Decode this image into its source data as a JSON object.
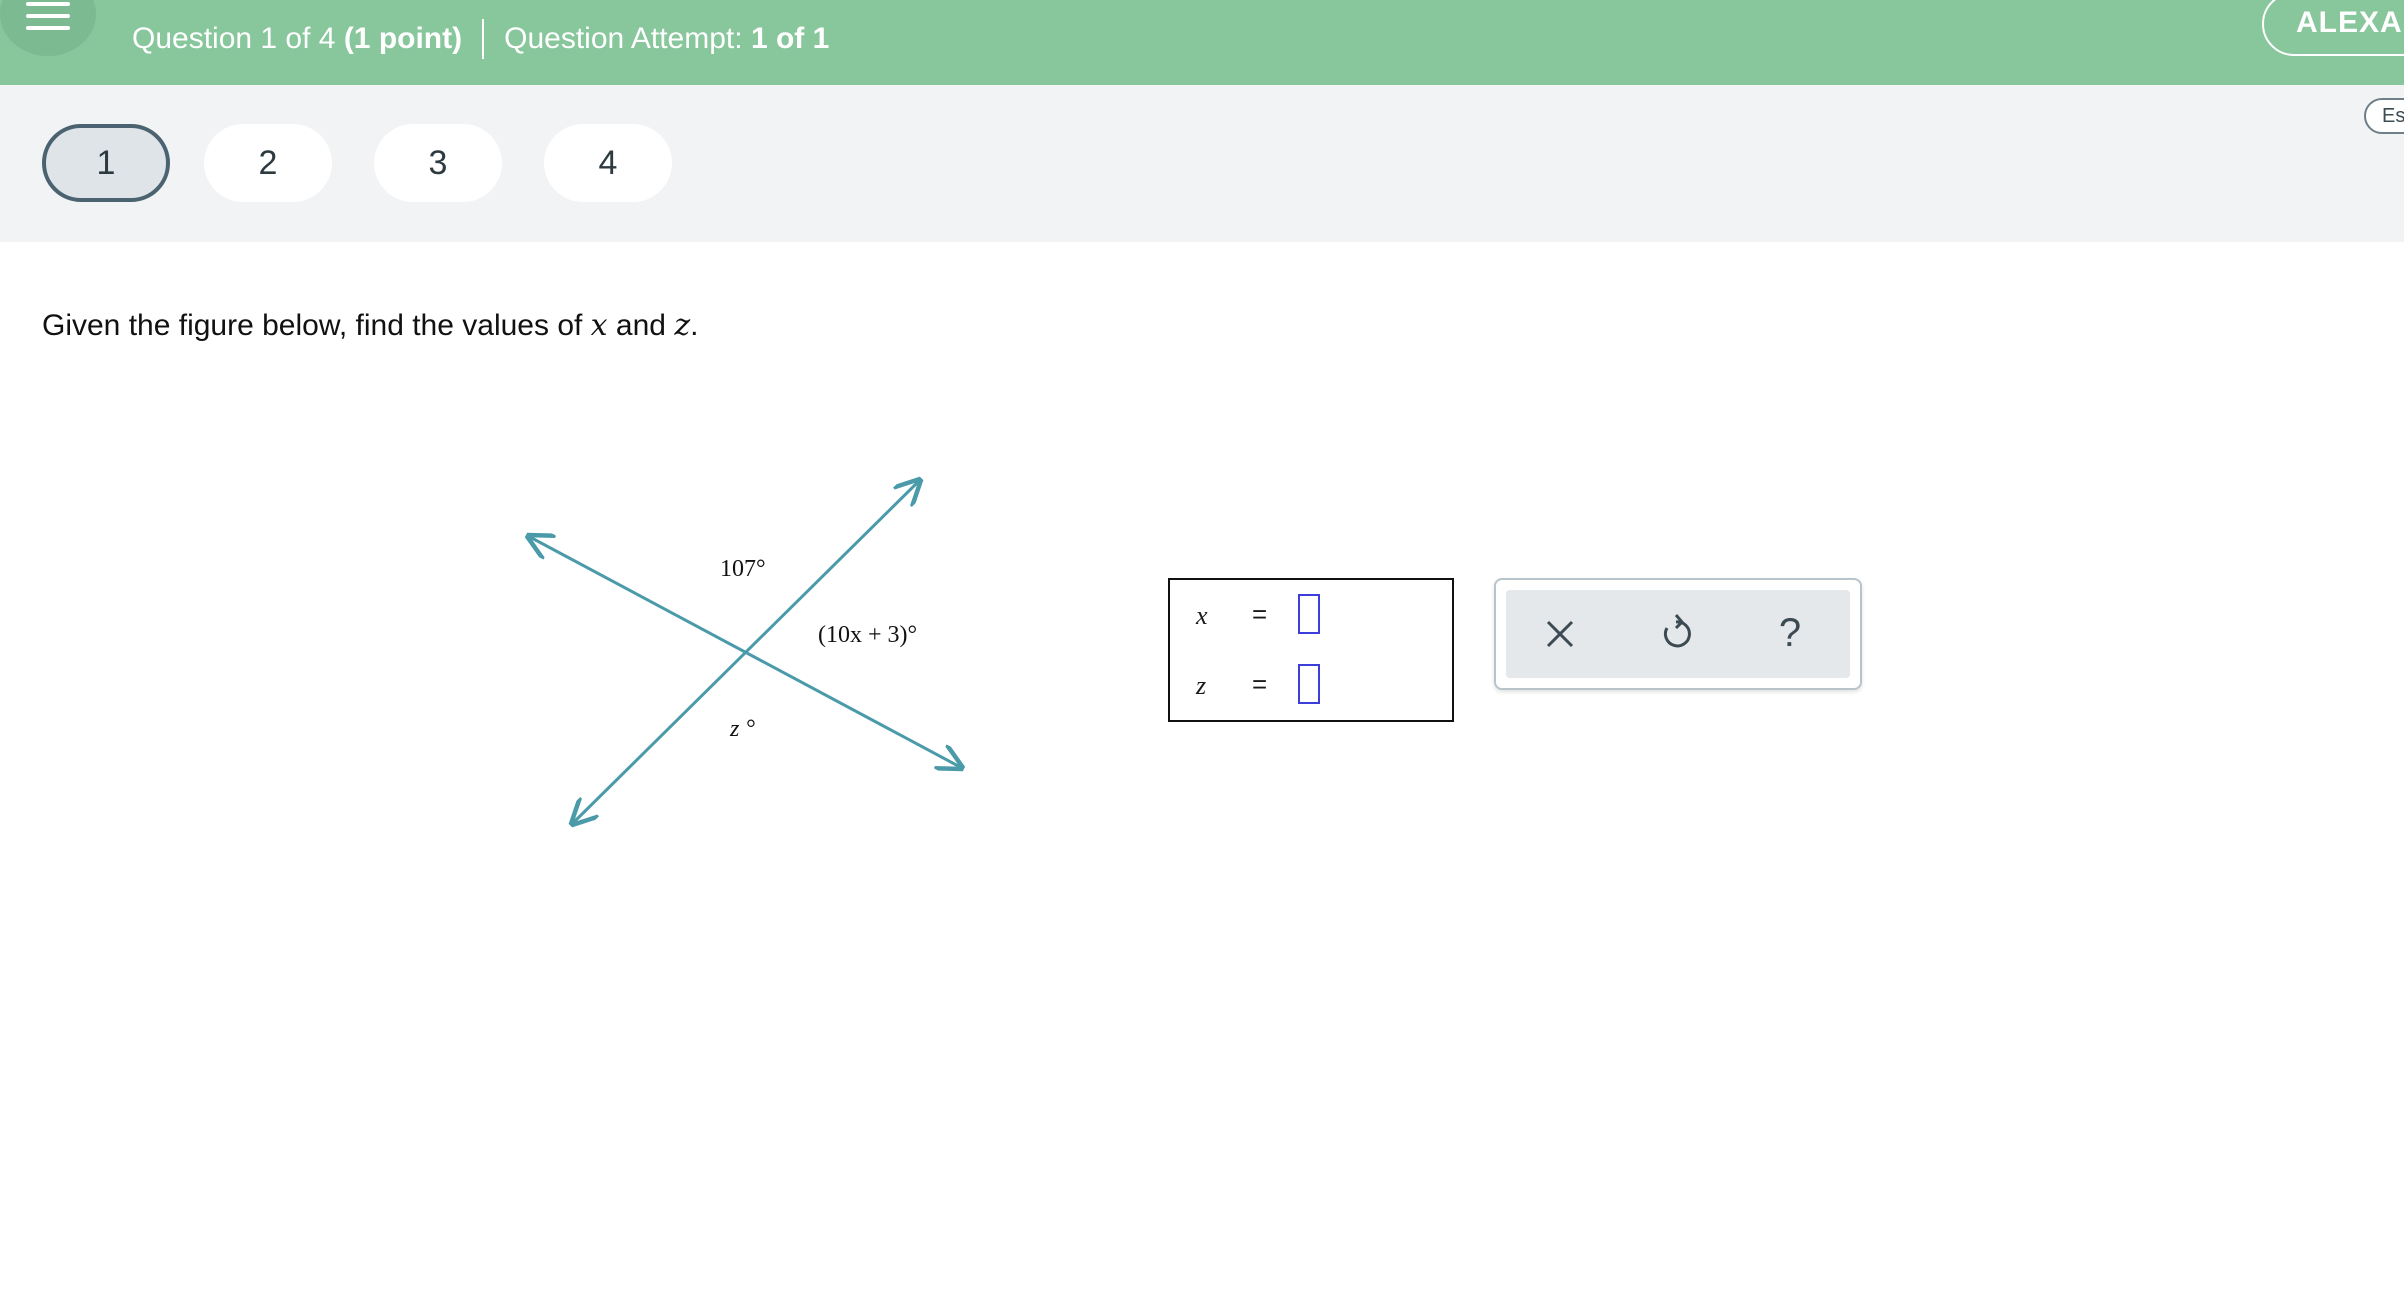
{
  "header": {
    "question_label": "Question 1 of 4",
    "points": "(1 point)",
    "attempt_label": "Question Attempt:",
    "attempt_value": "1 of 1",
    "user_name": "ALEXA"
  },
  "question_nav": {
    "items": [
      "1",
      "2",
      "3",
      "4"
    ],
    "active": "1",
    "language_button": "Es"
  },
  "question": {
    "prompt_start": "Given the figure below, find the values of ",
    "var1": "x",
    "prompt_mid": " and ",
    "var2": "z",
    "prompt_end": "."
  },
  "figure": {
    "label_top": "107°",
    "label_right": "(10x + 3)°",
    "label_bottom": "z °",
    "line_color": "#4a9aaa"
  },
  "answer": {
    "rows": [
      {
        "variable": "x",
        "equals": "=",
        "value": ""
      },
      {
        "variable": "z",
        "equals": "=",
        "value": ""
      }
    ]
  },
  "tools": {
    "buttons": [
      "clear-icon",
      "undo-icon",
      "help-icon"
    ],
    "help_glyph": "?"
  },
  "colors": {
    "header_bg": "#88c69c",
    "nav_bg": "#f1f3f4",
    "active_pill_border": "#4b6270",
    "answer_slot_border": "#3d3ddb"
  }
}
